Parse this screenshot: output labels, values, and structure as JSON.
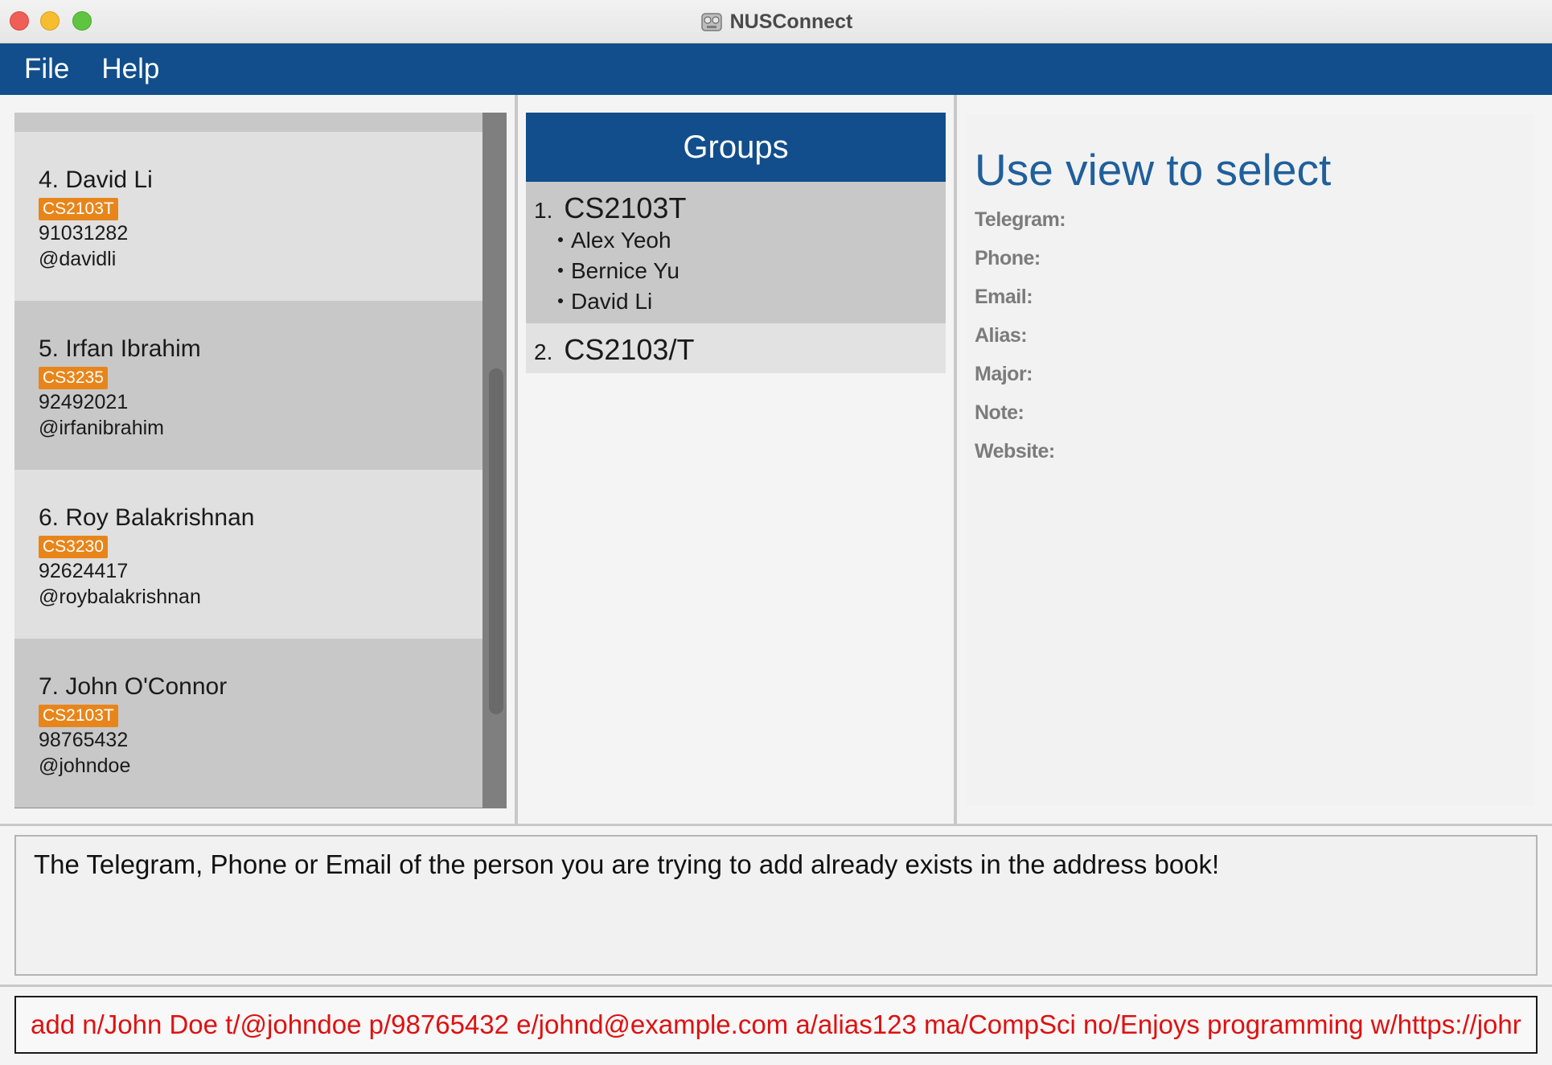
{
  "window": {
    "title": "NUSConnect"
  },
  "menu": {
    "file": "File",
    "help": "Help"
  },
  "persons": [
    {
      "name": "4. David Li",
      "tag": "CS2103T",
      "phone": "91031282",
      "telegram": "@davidli"
    },
    {
      "name": "5. Irfan Ibrahim",
      "tag": "CS3235",
      "phone": "92492021",
      "telegram": "@irfanibrahim"
    },
    {
      "name": "6. Roy Balakrishnan",
      "tag": "CS3230",
      "phone": "92624417",
      "telegram": "@roybalakrishnan"
    },
    {
      "name": "7. John O'Connor",
      "tag": "CS2103T",
      "phone": "98765432",
      "telegram": "@johndoe"
    }
  ],
  "groups": {
    "title": "Groups",
    "items": [
      {
        "index": "1.",
        "name": "CS2103T",
        "members": [
          "Alex Yeoh",
          "Bernice Yu",
          "David Li"
        ]
      },
      {
        "index": "2.",
        "name": "CS2103/T",
        "members": []
      }
    ]
  },
  "details": {
    "title": "Use view to select",
    "fields": [
      "Telegram:",
      "Phone:",
      "Email:",
      "Alias:",
      "Major:",
      "Note:",
      "Website:"
    ]
  },
  "result": {
    "message": "The Telegram, Phone or Email of the person you are trying to add already exists in the address book!"
  },
  "command": {
    "value": "add n/John Doe t/@johndoe p/98765432 e/johnd@example.com a/alias123 ma/CompSci no/Enjoys programming w/https://johr"
  },
  "colors": {
    "accent": "#114e8b",
    "tag": "#e8851a",
    "error": "#e01010",
    "detail_title": "#1f5f9b"
  }
}
